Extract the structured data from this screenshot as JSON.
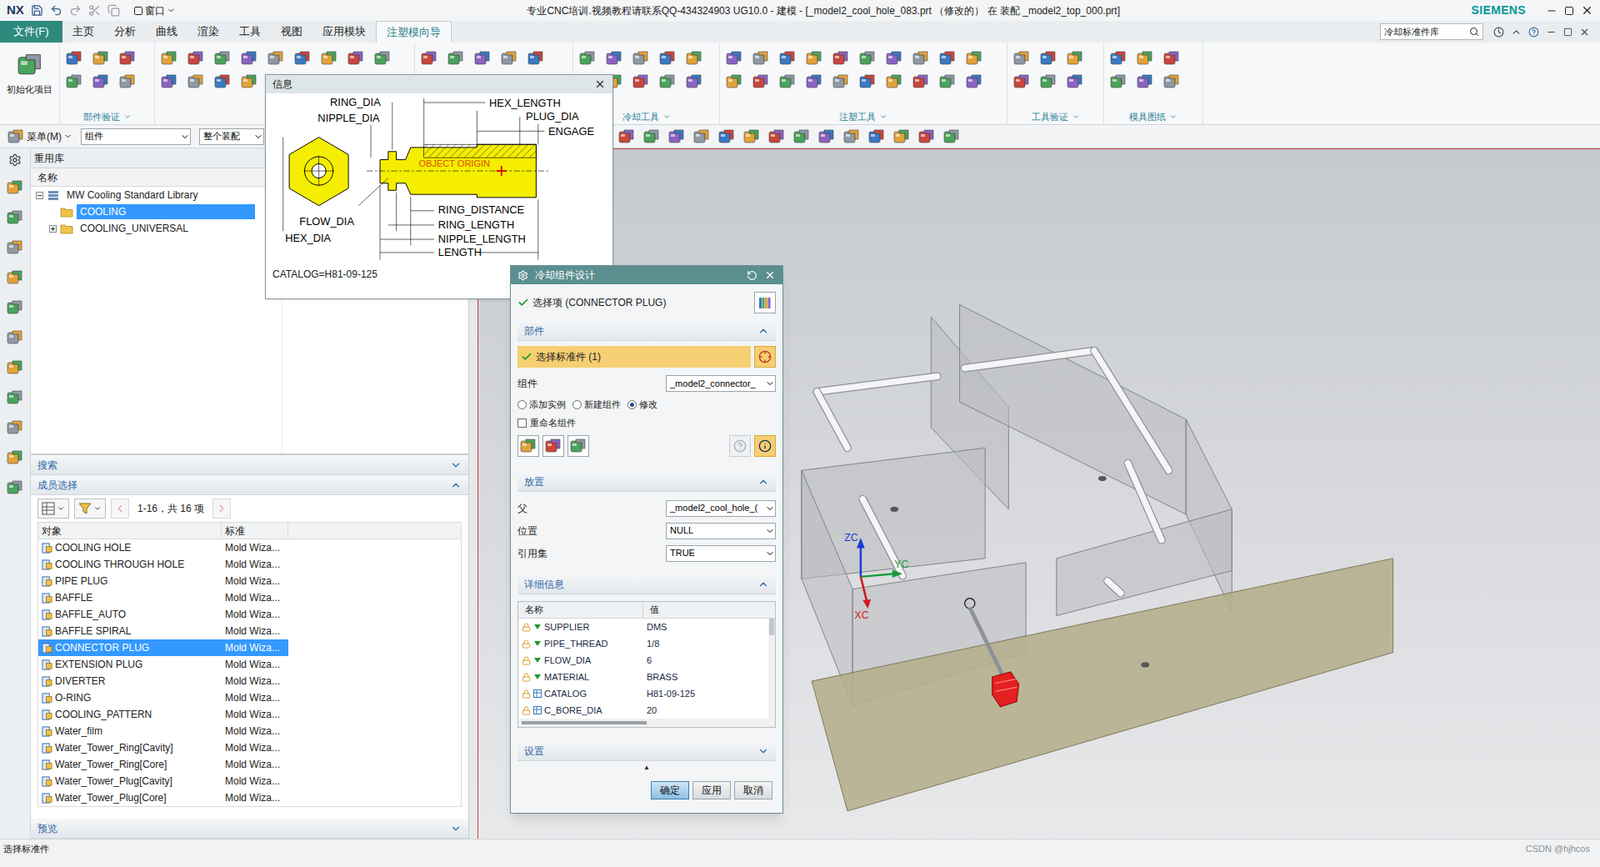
{
  "window": {
    "logo": "NX",
    "quick_menu": "窗口",
    "title": "专业CNC培训.视频教程请联系QQ-434324903 UG10.0 - 建模 - [_model2_cool_hole_083.prt （修改的） 在 装配 _model2_top_000.prt]",
    "brand": "SIEMENS"
  },
  "menu_tabs": [
    {
      "label": "文件(F)",
      "kind": "file",
      "selected": false
    },
    {
      "label": "主页",
      "kind": "tab",
      "selected": false
    },
    {
      "label": "分析",
      "kind": "tab",
      "selected": false
    },
    {
      "label": "曲线",
      "kind": "tab",
      "selected": false
    },
    {
      "label": "渲染",
      "kind": "tab",
      "selected": false
    },
    {
      "label": "工具",
      "kind": "tab",
      "selected": false
    },
    {
      "label": "视图",
      "kind": "tab",
      "selected": false
    },
    {
      "label": "应用模块",
      "kind": "tab",
      "selected": false
    },
    {
      "label": "注塑模向导",
      "kind": "tab",
      "selected": true
    }
  ],
  "search": {
    "value": "冷却标准件库"
  },
  "ribbon": {
    "init_button": "初始化项目",
    "group_labels": [
      "部件验证",
      "冷却工具",
      "注塑工具",
      "工具验证",
      "模具图纸"
    ]
  },
  "toolbar": {
    "menu": "菜单(M)",
    "filter": "组件",
    "scope": "整个装配"
  },
  "resource_panel": {
    "title": "重用库",
    "tree_column": "名称",
    "tree": {
      "label": "MW Cooling Standard Library",
      "expanded": true,
      "selected": false,
      "children": [
        {
          "label": "COOLING",
          "expandable": false,
          "expanded": false,
          "selected": true
        },
        {
          "label": "COOLING_UNIVERSAL",
          "expandable": true,
          "expanded": false,
          "selected": false
        }
      ]
    },
    "search_section": {
      "title": "搜索",
      "expanded": false
    },
    "members_section": {
      "title": "成员选择",
      "expanded": true,
      "pager": "1-16，共 16 项",
      "columns": [
        "对象",
        "标准"
      ],
      "rows": [
        {
          "object": "COOLING HOLE",
          "standard": "Mold Wiza...",
          "selected": false
        },
        {
          "object": "COOLING THROUGH HOLE",
          "standard": "Mold Wiza...",
          "selected": false
        },
        {
          "object": "PIPE PLUG",
          "standard": "Mold Wiza...",
          "selected": false
        },
        {
          "object": "BAFFLE",
          "standard": "Mold Wiza...",
          "selected": false
        },
        {
          "object": "BAFFLE_AUTO",
          "standard": "Mold Wiza...",
          "selected": false
        },
        {
          "object": "BAFFLE SPIRAL",
          "standard": "Mold Wiza...",
          "selected": false
        },
        {
          "object": "CONNECTOR PLUG",
          "standard": "Mold Wiza...",
          "selected": true
        },
        {
          "object": "EXTENSION PLUG",
          "standard": "Mold Wiza...",
          "selected": false
        },
        {
          "object": "DIVERTER",
          "standard": "Mold Wiza...",
          "selected": false
        },
        {
          "object": "O-RING",
          "standard": "Mold Wiza...",
          "selected": false
        },
        {
          "object": "COOLING_PATTERN",
          "standard": "Mold Wiza...",
          "selected": false
        },
        {
          "object": "Water_film",
          "standard": "Mold Wiza...",
          "selected": false
        },
        {
          "object": "Water_Tower_Ring[Cavity]",
          "standard": "Mold Wiza...",
          "selected": false
        },
        {
          "object": "Water_Tower_Ring[Core]",
          "standard": "Mold Wiza...",
          "selected": false
        },
        {
          "object": "Water_Tower_Plug[Cavity]",
          "standard": "Mold Wiza...",
          "selected": false
        },
        {
          "object": "Water_Tower_Plug[Core]",
          "standard": "Mold Wiza...",
          "selected": false
        }
      ]
    },
    "preview_section": {
      "title": "预览",
      "expanded": false
    }
  },
  "info_window": {
    "title": "信息",
    "dims": {
      "ring_dia": "RING_DIA",
      "nipple_dia": "NIPPLE_DIA",
      "hex_length": "HEX_LENGTH",
      "plug_dia": "PLUG_DIA",
      "engage": "ENGAGE",
      "object_origin": "OBJECT ORIGIN",
      "flow_dia": "FLOW_DIA",
      "hex_dia": "HEX_DIA",
      "ring_distance": "RING_DISTANCE",
      "ring_length": "RING_LENGTH",
      "nipple_length": "NIPPLE_LENGTH",
      "length": "LENGTH"
    },
    "catalog": "CATALOG=H81-09-125"
  },
  "design_dialog": {
    "title": "冷却组件设计",
    "selection_status": "选择项 (CONNECTOR PLUG)",
    "part_section": {
      "title": "部件",
      "expanded": true,
      "select_label": "选择标准件 (1)",
      "component_label": "组件",
      "component_value": "_model2_connector_",
      "modes": [
        {
          "label": "添加实例",
          "selected": false
        },
        {
          "label": "新建组件",
          "selected": false
        },
        {
          "label": "修改",
          "selected": true
        }
      ],
      "rename": {
        "label": "重命名组件",
        "checked": false
      }
    },
    "placement_section": {
      "title": "放置",
      "expanded": true,
      "fields": [
        {
          "label": "父",
          "value": "_model2_cool_hole_("
        },
        {
          "label": "位置",
          "value": "NULL"
        },
        {
          "label": "引用集",
          "value": "TRUE"
        }
      ]
    },
    "details_section": {
      "title": "详细信息",
      "expanded": true,
      "columns": [
        "名称",
        "值"
      ],
      "rows": [
        {
          "name": "SUPPLIER",
          "value": "DMS",
          "kind": "expression"
        },
        {
          "name": "PIPE_THREAD",
          "value": "1/8",
          "kind": "expression"
        },
        {
          "name": "FLOW_DIA",
          "value": "6",
          "kind": "expression"
        },
        {
          "name": "MATERIAL",
          "value": "BRASS",
          "kind": "expression"
        },
        {
          "name": "CATALOG",
          "value": "H81-09-125",
          "kind": "table"
        },
        {
          "name": "C_BORE_DIA",
          "value": "20",
          "kind": "table"
        }
      ]
    },
    "settings_section": {
      "title": "设置",
      "expanded": false
    },
    "more": "▲",
    "buttons": [
      {
        "label": "确定",
        "selected": true
      },
      {
        "label": "应用",
        "selected": false
      },
      {
        "label": "取消",
        "selected": false
      }
    ]
  },
  "viewport": {
    "axes": {
      "zc": "ZC",
      "yc": "YC",
      "xc": "XC"
    }
  },
  "status_bar": {
    "message": "选择标准件",
    "watermark": "CSDN @hjhcos"
  }
}
